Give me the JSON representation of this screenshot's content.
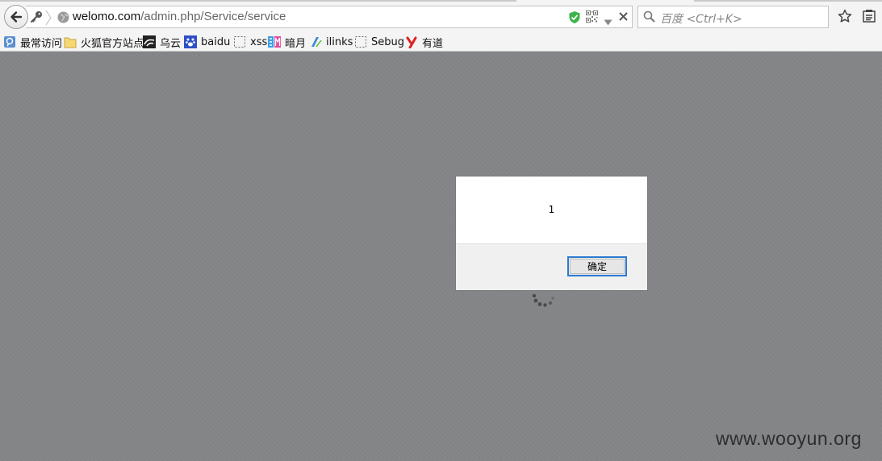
{
  "address_bar": {
    "url_host": "welomo.com",
    "url_path": "/admin.php/Service/service"
  },
  "search_bar": {
    "placeholder": "百度 <Ctrl+K>"
  },
  "bookmarks": [
    {
      "label": "最常访问",
      "icon": "most-visited-icon"
    },
    {
      "label": "火狐官方站点",
      "icon": "folder-icon"
    },
    {
      "label": "乌云",
      "icon": "wooyun-icon"
    },
    {
      "label": "baidu",
      "icon": "baidu-paw-icon"
    },
    {
      "label": "xss",
      "icon": "page-placeholder-icon"
    },
    {
      "label": "暗月",
      "icon": "anyue-icon"
    },
    {
      "label": "ilinks",
      "icon": "ilinks-icon"
    },
    {
      "label": "Sebug",
      "icon": "page-placeholder-icon"
    },
    {
      "label": "有道",
      "icon": "youdao-icon"
    }
  ],
  "dialog": {
    "message": "1",
    "ok_label": "确定"
  },
  "watermark": "www.wooyun.org",
  "colors": {
    "page_overlay": "#84878a",
    "dialog_button_border": "#2a7ad3",
    "shield_green": "#3bb54a"
  }
}
